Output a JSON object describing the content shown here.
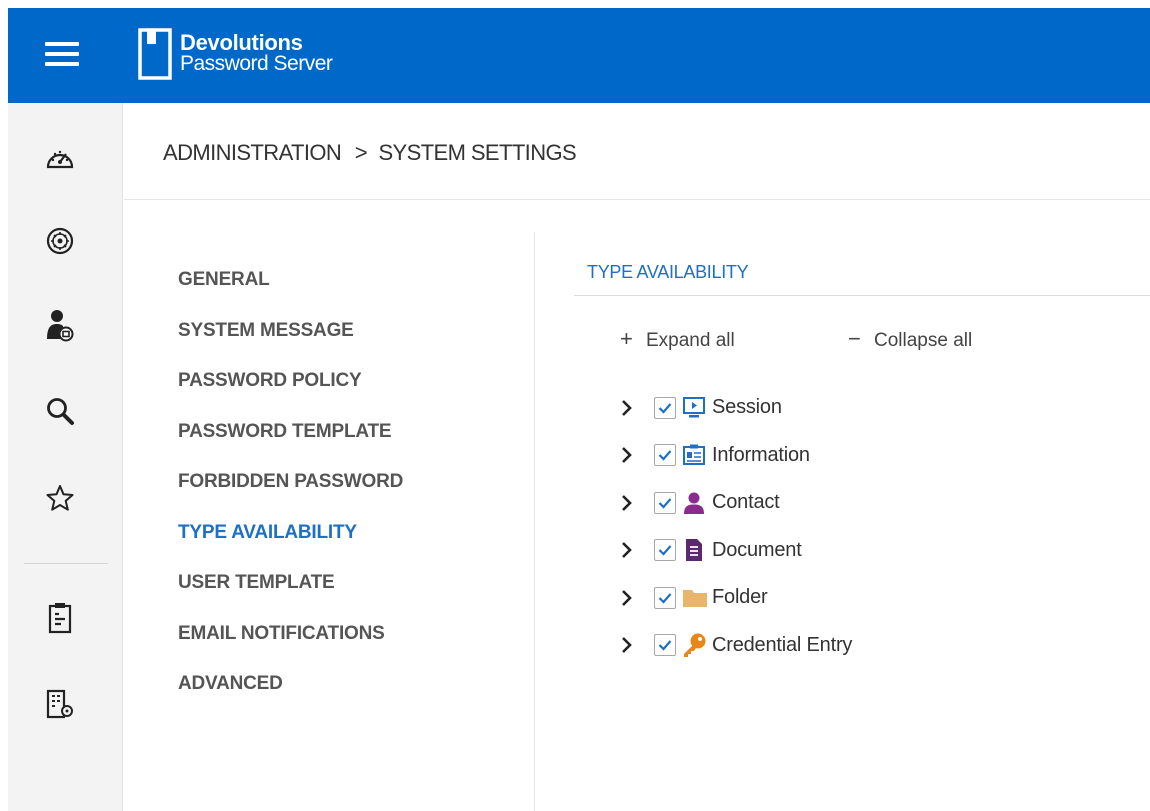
{
  "app": {
    "brand_line1": "Devolutions",
    "brand_line2": "Password Server",
    "brand_color": "#0068c8"
  },
  "sidebar": {
    "icons": [
      "dashboard-icon",
      "administration-icon",
      "user-security-icon",
      "search-icon",
      "favorites-icon",
      "reports-icon",
      "system-settings-icon"
    ]
  },
  "breadcrumb": {
    "parent": "ADMINISTRATION",
    "separator": ">",
    "current": "SYSTEM SETTINGS"
  },
  "settings_menu": {
    "items": [
      "GENERAL",
      "SYSTEM MESSAGE",
      "PASSWORD POLICY",
      "PASSWORD TEMPLATE",
      "FORBIDDEN PASSWORD",
      "TYPE AVAILABILITY",
      "USER TEMPLATE",
      "EMAIL NOTIFICATIONS",
      "ADVANCED"
    ],
    "active": "TYPE AVAILABILITY",
    "active_color": "#1e6fc6"
  },
  "content": {
    "title": "TYPE AVAILABILITY",
    "expand_label": "Expand all",
    "collapse_label": "Collapse all",
    "tree": [
      {
        "label": "Session",
        "checked": true,
        "icon": "session-icon"
      },
      {
        "label": "Information",
        "checked": true,
        "icon": "information-icon"
      },
      {
        "label": "Contact",
        "checked": true,
        "icon": "contact-icon"
      },
      {
        "label": "Document",
        "checked": true,
        "icon": "document-icon"
      },
      {
        "label": "Folder",
        "checked": true,
        "icon": "folder-icon"
      },
      {
        "label": "Credential Entry",
        "checked": true,
        "icon": "key-icon"
      }
    ]
  }
}
